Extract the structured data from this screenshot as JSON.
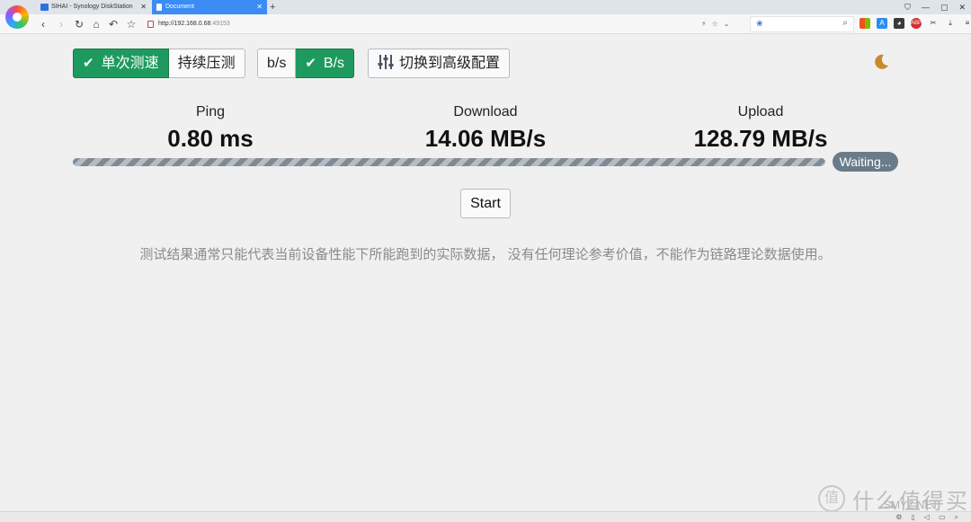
{
  "browser": {
    "tabs": [
      {
        "label": "SIHAI - Synology DiskStation",
        "active": false
      },
      {
        "label": "Document",
        "active": true
      }
    ],
    "new_tab_label": "+",
    "url_host": "http://192.168.0.68",
    "url_port": ":49153",
    "window_controls": [
      "⛉",
      "—",
      "▢",
      "✕"
    ]
  },
  "controls": {
    "mode_single": "单次测速",
    "mode_continuous": "持续压测",
    "unit_bits": "b/s",
    "unit_bytes": "B/s",
    "advanced": "切换到高级配置"
  },
  "metrics": {
    "ping_label": "Ping",
    "ping_value": "0.80 ms",
    "download_label": "Download",
    "download_value": "14.06 MB/s",
    "upload_label": "Upload",
    "upload_value": "128.79 MB/s"
  },
  "progress": {
    "status": "Waiting..."
  },
  "start_label": "Start",
  "disclaimer": "测试结果通常只能代表当前设备性能下所能跑到的实际数据， 没有任何理论参考价值，不能作为链路理论数据使用。",
  "watermark": {
    "badge": "值",
    "text": "什么值得买",
    "sub": "SMYZ.NET"
  },
  "colors": {
    "accent": "#1f9a5e",
    "pill": "#6a7c89",
    "moon": "#c98a2c"
  }
}
